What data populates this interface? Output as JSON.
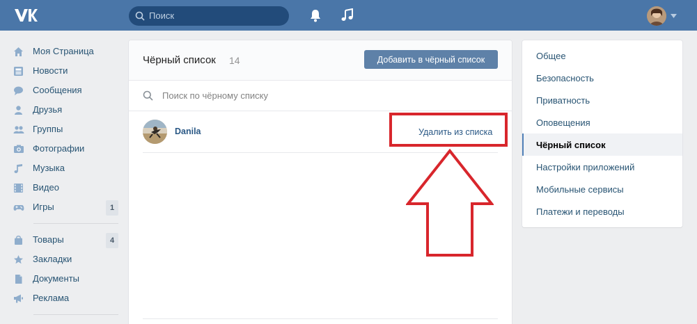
{
  "header": {
    "search_placeholder": "Поиск"
  },
  "left_menu": {
    "main": [
      {
        "label": "Моя Страница",
        "icon": "home-icon"
      },
      {
        "label": "Новости",
        "icon": "news-icon"
      },
      {
        "label": "Сообщения",
        "icon": "messages-icon"
      },
      {
        "label": "Друзья",
        "icon": "friends-icon"
      },
      {
        "label": "Группы",
        "icon": "groups-icon"
      },
      {
        "label": "Фотографии",
        "icon": "photos-icon"
      },
      {
        "label": "Музыка",
        "icon": "music-icon"
      },
      {
        "label": "Видео",
        "icon": "video-icon"
      },
      {
        "label": "Игры",
        "icon": "games-icon",
        "badge": "1"
      }
    ],
    "secondary": [
      {
        "label": "Товары",
        "icon": "market-icon",
        "badge": "4"
      },
      {
        "label": "Закладки",
        "icon": "bookmarks-icon"
      },
      {
        "label": "Документы",
        "icon": "documents-icon"
      },
      {
        "label": "Реклама",
        "icon": "ads-icon"
      }
    ]
  },
  "blacklist": {
    "title": "Чёрный список",
    "count": "14",
    "add_button": "Добавить в чёрный список",
    "search_placeholder": "Поиск по чёрному списку",
    "entries": [
      {
        "name": "Danila",
        "action": "Удалить из списка"
      }
    ]
  },
  "settings_menu": {
    "items": [
      {
        "label": "Общее",
        "active": false
      },
      {
        "label": "Безопасность",
        "active": false
      },
      {
        "label": "Приватность",
        "active": false
      },
      {
        "label": "Оповещения",
        "active": false
      },
      {
        "label": "Чёрный список",
        "active": true
      },
      {
        "label": "Настройки приложений",
        "active": false
      },
      {
        "label": "Мобильные сервисы",
        "active": false
      },
      {
        "label": "Платежи и переводы",
        "active": false
      }
    ]
  },
  "colors": {
    "header": "#4a76a8",
    "link": "#2a5885",
    "annotation_red": "#d8262c"
  }
}
